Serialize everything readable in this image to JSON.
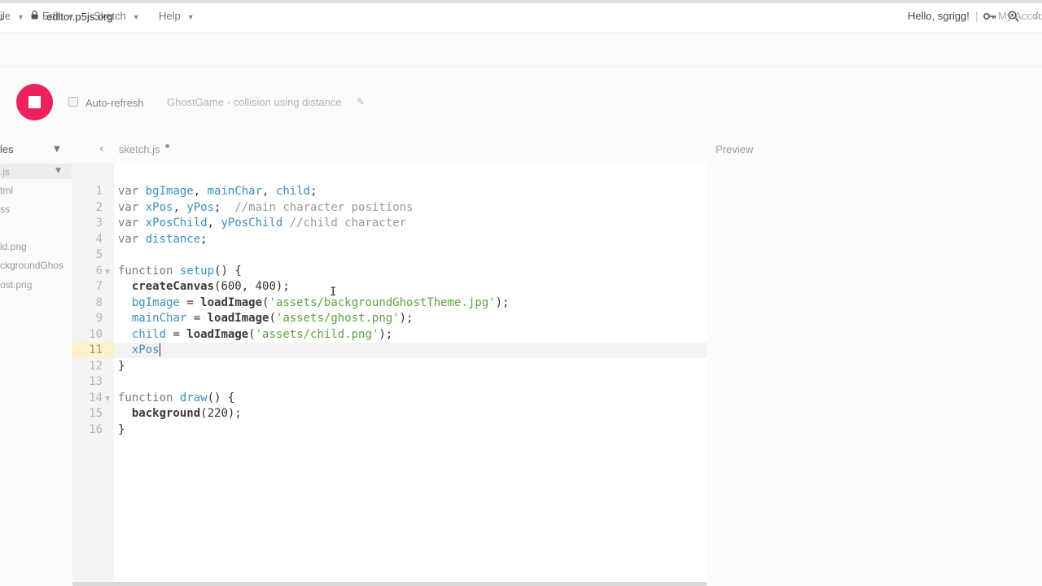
{
  "browser": {
    "url": "editor.p5js.org",
    "icons": [
      "reload-icon",
      "lock-icon",
      "key-icon",
      "zoom-icon",
      "star-icon"
    ]
  },
  "menu": {
    "file": "ile",
    "edit": "Edit",
    "sketch": "Sketch",
    "help": "Help",
    "greeting": "Hello, sgrigg!",
    "separator": "|",
    "account": "My Accou"
  },
  "toolbar": {
    "auto_refresh": "Auto-refresh",
    "sketch_name": "GhostGame - collision using distance",
    "pencil": "✎"
  },
  "sidebar": {
    "label": "les",
    "files": [
      ".js",
      "tml",
      "ss",
      "ld.png",
      "ckgroundGhos",
      "ost.png"
    ]
  },
  "editor": {
    "tab": "sketch.js",
    "preview": "Preview",
    "line_numbers": [
      "1",
      "2",
      "3",
      "4",
      "5",
      "6",
      "7",
      "8",
      "9",
      "10",
      "11",
      "12",
      "13",
      "14",
      "15",
      "16"
    ],
    "lines": [
      "var bgImage, mainChar, child;",
      "var xPos, yPos;  //main character positions",
      "var xPosChild, yPosChild //child character",
      "var distance;",
      "",
      "function setup() {",
      "  createCanvas(600, 400);",
      "  bgImage = loadImage('assets/backgroundGhostTheme.jpg');",
      "  mainChar = loadImage('assets/ghost.png');",
      "  child = loadImage('assets/child.png');",
      "  xPos",
      "}",
      "",
      "function draw() {",
      "  background(220);",
      "}"
    ]
  },
  "colors": {
    "accent": "#ed225d",
    "keyword": "#7a7a7a",
    "variable": "#3a8fbf",
    "string": "#58a33d",
    "comment": "#999999",
    "active_gutter": "#fdf1c8"
  }
}
